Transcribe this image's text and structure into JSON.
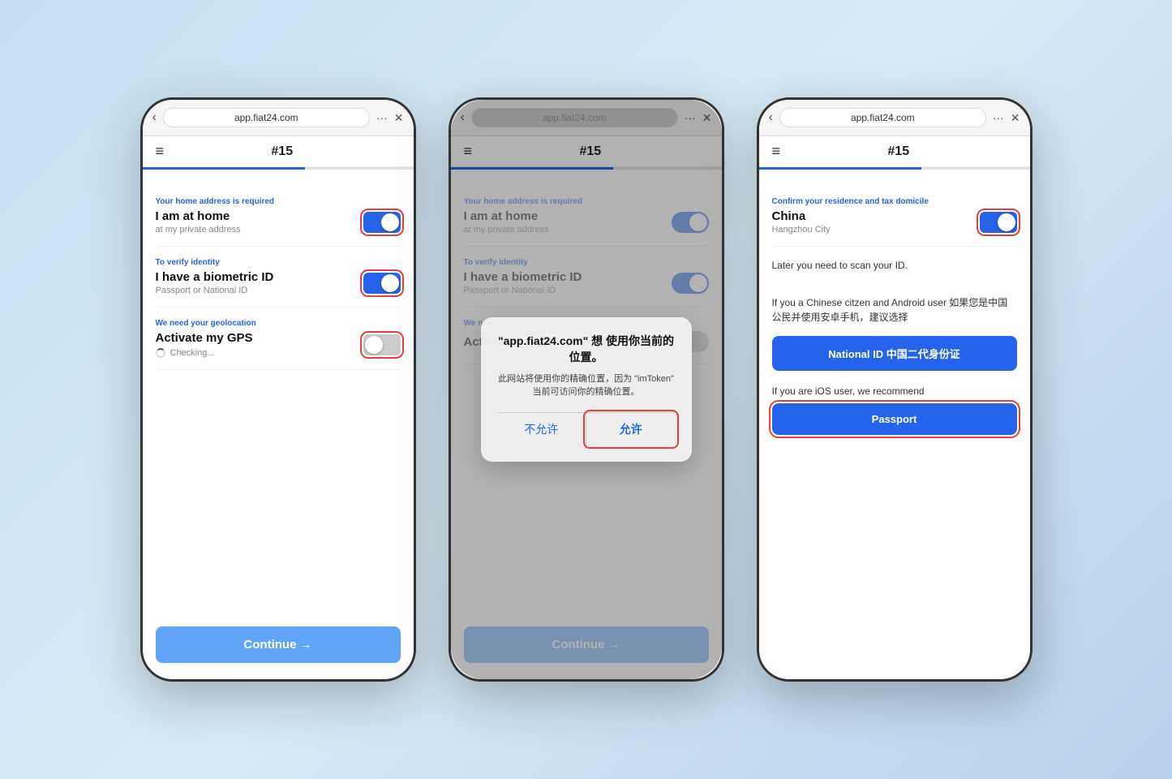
{
  "page": {
    "background": "#c8dff0"
  },
  "phone1": {
    "browser": {
      "url": "app.fiat24.com",
      "dots": "···",
      "close": "✕",
      "back": "‹"
    },
    "header": {
      "hamburger": "≡",
      "title": "#15"
    },
    "sections": [
      {
        "smallLabel": "Your home address is required",
        "mainLabel": "I am at home",
        "subLabel": "at my private address",
        "toggleOn": true,
        "highlighted": true
      },
      {
        "smallLabel": "To verify identity",
        "mainLabel": "I have a biometric ID",
        "subLabel": "Passport or National ID",
        "toggleOn": true,
        "highlighted": true
      },
      {
        "smallLabel": "We need your geolocation",
        "mainLabel": "Activate my GPS",
        "subLabel": "",
        "toggleOn": false,
        "highlighted": true,
        "checking": true
      }
    ],
    "continueBtn": "Continue →"
  },
  "phone2": {
    "browser": {
      "url": "app.fiat24.com",
      "dots": "···",
      "close": "✕",
      "back": "‹"
    },
    "header": {
      "hamburger": "≡",
      "title": "#15"
    },
    "sections": [
      {
        "smallLabel": "Your home address is required",
        "mainLabel": "I am at home",
        "subLabel": "at my private address",
        "toggleOn": true
      },
      {
        "smallLabel": "To verify identity",
        "mainLabel": "I have a biometric ID",
        "subLabel": "Passport or National ID",
        "toggleOn": true
      },
      {
        "smallLabel": "We need your geolocation",
        "mainLabel": "Activate my GPS",
        "subLabel": "",
        "toggleOn": false
      }
    ],
    "continueBtn": "Continue →",
    "dialog": {
      "title": "\"app.fiat24.com\" 想\n使用你当前的位置。",
      "body": "此网站将使用你的精确位置，因为 \"imToken\" 当前可访问你的精确位置。",
      "cancelBtn": "不允许",
      "confirmBtn": "允许",
      "confirmHighlighted": true
    }
  },
  "phone3": {
    "browser": {
      "url": "app.fiat24.com",
      "dots": "···",
      "close": "✕",
      "back": "‹"
    },
    "header": {
      "hamburger": "≡",
      "title": "#15"
    },
    "residence": {
      "smallLabel": "Confirm your residence and tax domicile",
      "mainLabel": "China",
      "subLabel": "Hangzhou City",
      "toggleOn": true,
      "highlighted": true
    },
    "infoText1": "Later you need to scan your ID.",
    "infoText2": "If you a Chinese citzen and Android user 如果您是中国公民并使用安卓手机，建议选择",
    "nationalIdBtn": "National ID 中国二代身份证",
    "infoText3": "If you are iOS user, we recommend",
    "passportBtn": "Passport",
    "passportHighlighted": true
  }
}
